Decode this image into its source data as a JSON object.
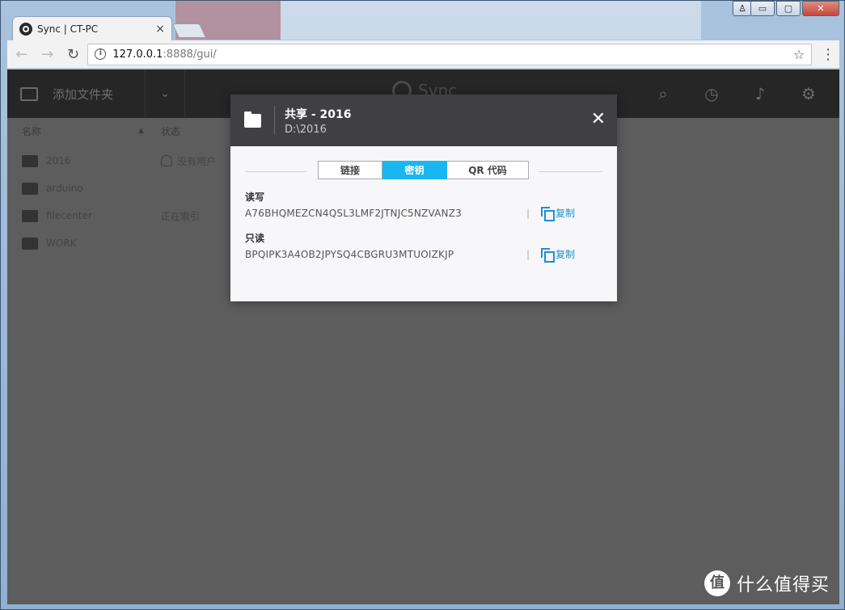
{
  "browser": {
    "tab_title": "Sync | CT-PC",
    "tab_close": "×",
    "url_host": "127.0.0.1",
    "url_rest": ":8888/gui/",
    "back": "←",
    "forward": "→",
    "reload": "↻",
    "star": "☆",
    "menu": "⋮",
    "win_min": "▭",
    "win_max": "▢",
    "win_close": "✕",
    "user": "♙"
  },
  "app": {
    "add_folder_label": "添加文件夹",
    "dropdown_chevron": "⌄",
    "logo_text": "Sync",
    "icons": [
      "search-icon",
      "history-icon",
      "notification-icon",
      "settings-icon"
    ]
  },
  "list": {
    "header_name": "名称",
    "header_sort": "▲",
    "header_status": "状态",
    "rows": [
      {
        "name": "2016",
        "status": "没有用户"
      },
      {
        "name": "arduino",
        "status": ""
      },
      {
        "name": "filecenter",
        "status": "正在索引"
      },
      {
        "name": "WORK",
        "status": ""
      }
    ]
  },
  "modal": {
    "title": "共享 - 2016",
    "path": "D:\\2016",
    "close": "✕",
    "tabs": [
      {
        "label": "链接",
        "active": false
      },
      {
        "label": "密钥",
        "active": true
      },
      {
        "label": "QR 代码",
        "active": false
      }
    ],
    "keys": [
      {
        "label": "读写",
        "value": "A76BHQMEZCN4QSL3LMF2JTNJC5NZVANZ3",
        "copy_label": "复制"
      },
      {
        "label": "只读",
        "value": "BPQIPK3A4OB2JPYSQ4CBGRU3MTUOIZKJP",
        "copy_label": "复制"
      }
    ],
    "separator": "|"
  },
  "watermark": {
    "logo": "值",
    "text": "什么值得买"
  },
  "colors": {
    "accent": "#19b7ef",
    "link": "#1d8fd0",
    "overlay": "#5d5d5d",
    "modal_header": "#404042"
  }
}
